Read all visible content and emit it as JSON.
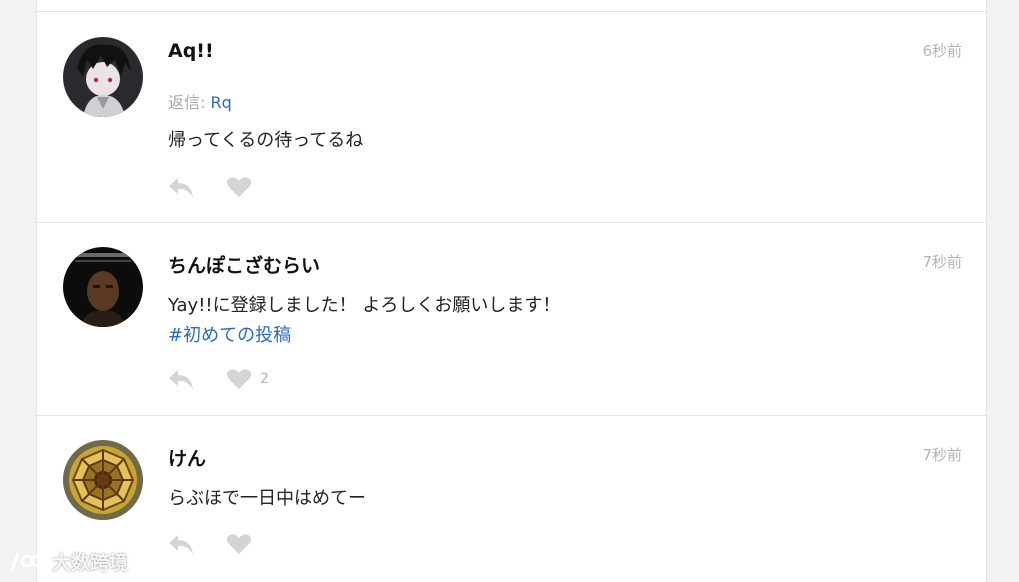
{
  "posts": [
    {
      "author": "Aq!!",
      "time": "6秒前",
      "reply_prefix": "返信: ",
      "reply_target": "Rq",
      "text": "帰ってくるの待ってるね",
      "likes": ""
    },
    {
      "author": "ちんぽこざむらい",
      "time": "7秒前",
      "text": "Yay!!に登録しました！ よろしくお願いします！",
      "hashtag": "#初めての投稿",
      "likes": "2"
    },
    {
      "author": "けん",
      "time": "7秒前",
      "text": "らぶほで一日中はめてー",
      "likes": ""
    }
  ],
  "watermark": "大数跨境",
  "colors": {
    "link": "#2b6db8",
    "muted": "#b4b4b4",
    "icon": "#d4d4d4"
  },
  "icons": {
    "reply": "reply-arrow-icon",
    "like": "heart-icon"
  }
}
